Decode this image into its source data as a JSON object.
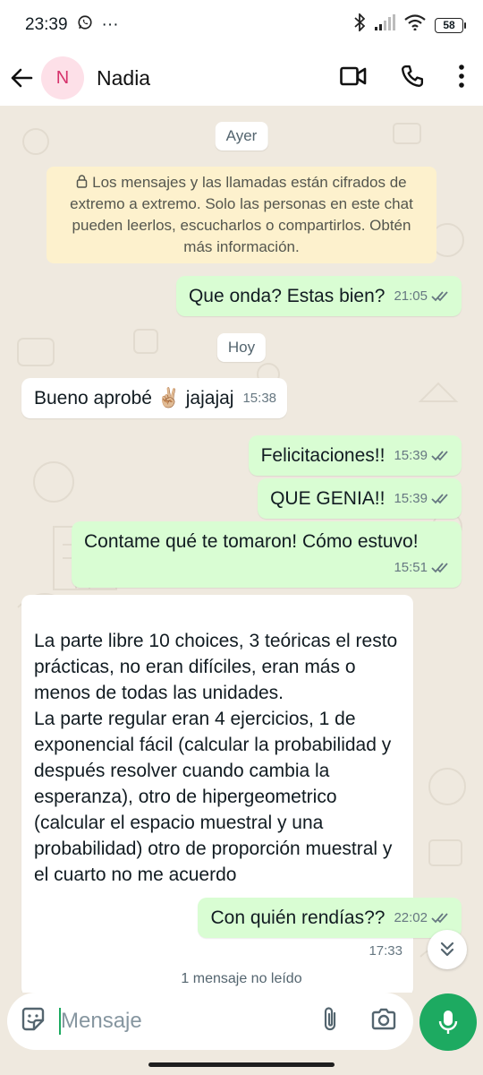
{
  "status_bar": {
    "time": "23:39",
    "more": "···",
    "battery": "58"
  },
  "header": {
    "avatar_letter": "N",
    "contact_name": "Nadia"
  },
  "chat": {
    "date_ayer": "Ayer",
    "encryption_note": "Los mensajes y las llamadas están cifrados de extremo a extremo. Solo las personas en este chat pueden leerlos, escucharlos o compartirlos. Obtén más información.",
    "date_hoy": "Hoy",
    "messages": [
      {
        "text": "Que onda? Estas bien?",
        "time": "21:05"
      },
      {
        "text": "Bueno aprobé ✌🏼 jajajaj",
        "time": "15:38"
      },
      {
        "text": "Felicitaciones!!",
        "time": "15:39"
      },
      {
        "text": "QUE GENIA!!",
        "time": "15:39"
      },
      {
        "text": "Contame qué te tomaron! Cómo estuvo!",
        "time": "15:51"
      },
      {
        "text": "La parte libre 10 choices, 3 teóricas el resto prácticas, no eran difíciles, eran más o menos de todas las unidades.\nLa parte regular eran 4 ejercicios, 1 de exponencial fácil (calcular la probabilidad y después resolver cuando cambia la esperanza), otro de hipergeometrico (calcular el espacio muestral y una probabilidad) otro de proporción muestral y el cuarto no me acuerdo",
        "time": "17:33"
      },
      {
        "text": "Con quién rendías??",
        "time": "22:02"
      }
    ],
    "unread_label": "1 mensaje no leído"
  },
  "input": {
    "placeholder": "Mensaje"
  },
  "colors": {
    "outgoing_bubble": "#d9fdd3",
    "incoming_bubble": "#ffffff",
    "accent": "#1daa61",
    "chat_bg": "#efe9df",
    "system_note": "#fdf1cd"
  }
}
